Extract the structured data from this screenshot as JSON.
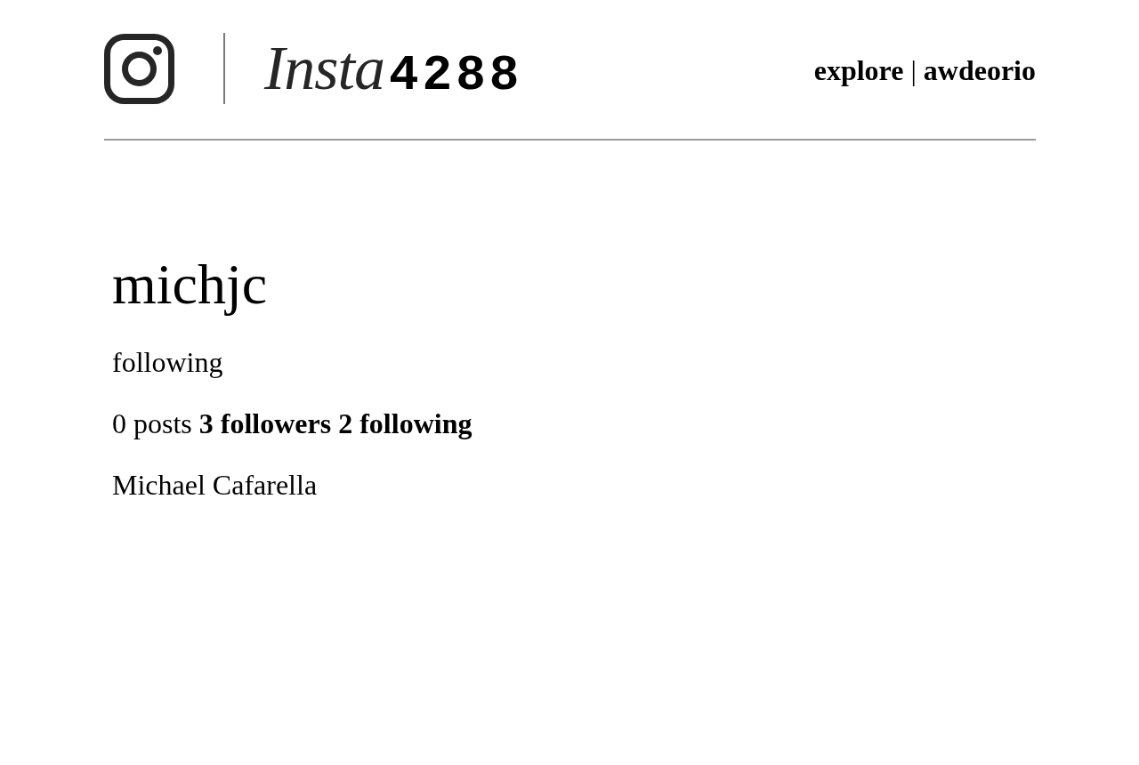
{
  "header": {
    "logo": {
      "wordmark": "Insta",
      "number": "4288"
    },
    "nav": {
      "links": [
        {
          "label": "explore"
        },
        {
          "label": "awdeorio"
        }
      ],
      "separator": "|"
    }
  },
  "profile": {
    "username": "michjc",
    "relationship": "following",
    "stats": [
      {
        "kind": "text",
        "label": "0 posts"
      },
      {
        "kind": "link",
        "label": "3 followers"
      },
      {
        "kind": "link",
        "label": "2 following"
      }
    ],
    "full_name": "Michael Cafarella"
  }
}
